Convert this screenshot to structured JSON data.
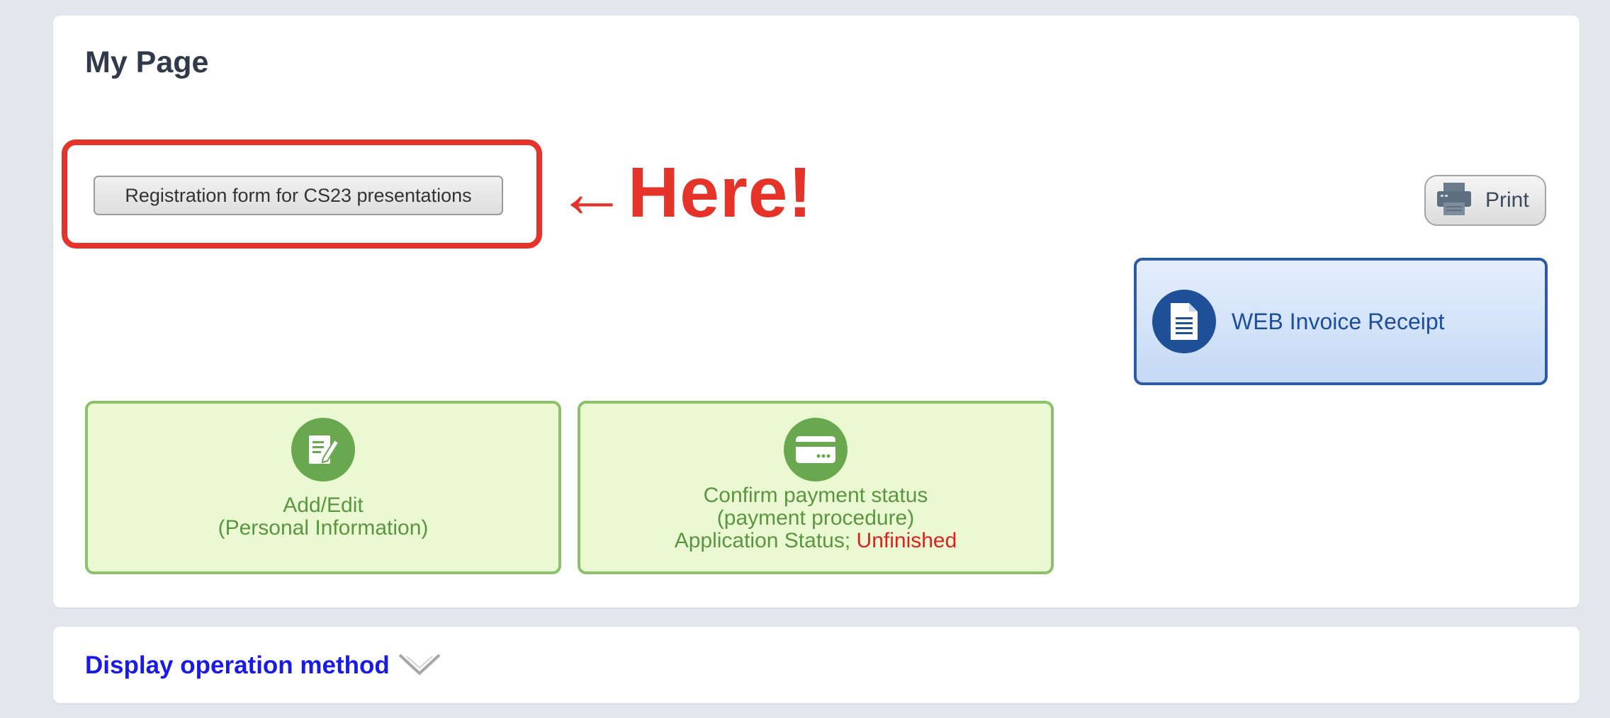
{
  "page": {
    "title": "My Page"
  },
  "registration": {
    "button_label": "Registration form for CS23 presentations"
  },
  "annotation": {
    "text": "←Here!",
    "color": "#e5332a"
  },
  "toolbar": {
    "print_label": "Print",
    "print_icon": "printer-icon"
  },
  "invoice": {
    "label": "WEB Invoice Receipt",
    "icon": "document-icon",
    "accent": "#2d5aa5"
  },
  "tiles": {
    "add_edit": {
      "icon": "edit-icon",
      "line1": "Add/Edit",
      "line2": "(Personal Information)"
    },
    "payment": {
      "icon": "credit-card-icon",
      "line1": "Confirm payment status",
      "line2": "(payment procedure)",
      "status_label": "Application Status; ",
      "status_value": "Unfinished",
      "status_color": "#e02020"
    }
  },
  "footer": {
    "link_label": "Display operation method",
    "icon": "chevron-down-icon"
  }
}
